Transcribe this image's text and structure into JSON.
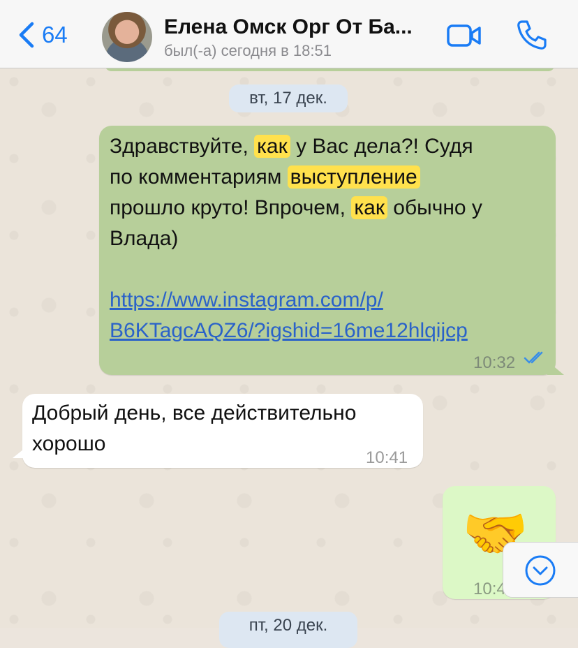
{
  "header": {
    "back_count": "64",
    "contact_name": "Елена Омск Орг От Ба...",
    "last_seen": "был(-а) сегодня в 18:51"
  },
  "dates": {
    "first": "вт, 17 дек.",
    "second": "пт, 20 дек."
  },
  "messages": [
    {
      "direction": "outgoing",
      "text_parts": [
        "Здравствуйте, ",
        "как",
        " у Вас дела?! Судя",
        "по комментариям ",
        "выступление",
        "прошло круто! Впрочем, ",
        "как",
        " обычно у",
        "Влада)"
      ],
      "link_line1": "https://www.instagram.com/p/",
      "link_line2": "B6KTagcAQZ6/?igshid=16me12hlqijcp",
      "time": "10:32",
      "status": "read"
    },
    {
      "direction": "incoming",
      "line1": "Добрый день, все действительно",
      "line2": "хорошо",
      "time": "10:41"
    },
    {
      "direction": "outgoing",
      "emoji": "🤝",
      "time": "10:4"
    }
  ],
  "colors": {
    "accent": "#1a7cf5",
    "outgoing_bubble": "#b7cf9a",
    "highlight": "#ffe14d"
  }
}
